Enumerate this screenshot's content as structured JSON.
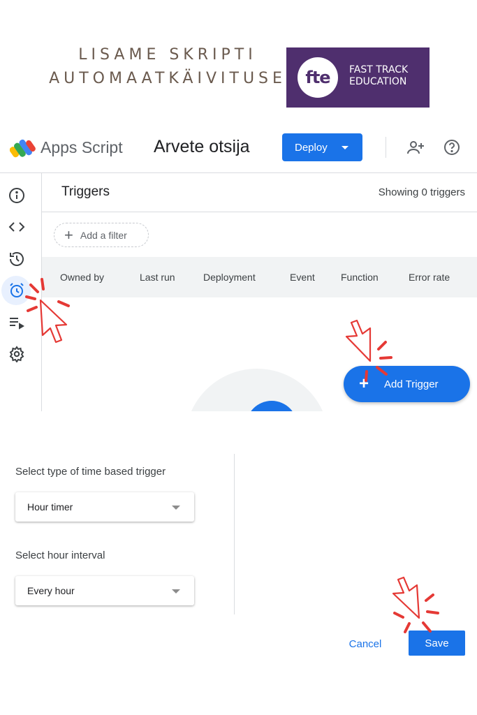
{
  "banner": {
    "line1": "LISAME SKRIPTI",
    "line2": "AUTOMAATKÄIVITUSE",
    "logo_mark": "fte",
    "logo_line1": "FAST TRACK",
    "logo_line2": "EDUCATION",
    "logo_bg": "#4f2f6e"
  },
  "app": {
    "brand": "Apps Script",
    "project_name": "Arvete otsija",
    "deploy_label": "Deploy",
    "accent": "#1a73e8",
    "header_icons": [
      "add-person-icon",
      "help-icon"
    ]
  },
  "sidebar": {
    "items": [
      {
        "name": "overview",
        "icon": "info-icon"
      },
      {
        "name": "editor",
        "icon": "code-icon"
      },
      {
        "name": "executions",
        "icon": "history-icon"
      },
      {
        "name": "triggers",
        "icon": "alarm-icon",
        "active": true
      },
      {
        "name": "executions-list",
        "icon": "playlist-icon"
      },
      {
        "name": "settings",
        "icon": "gear-icon"
      }
    ]
  },
  "triggers": {
    "title": "Triggers",
    "showing": "Showing 0 triggers",
    "filter_placeholder": "Add a filter",
    "columns": [
      "Owned by",
      "Last run",
      "Deployment",
      "Event",
      "Function",
      "Error rate"
    ],
    "add_button": "Add Trigger"
  },
  "dialog": {
    "type_label": "Select type of time based trigger",
    "type_value": "Hour timer",
    "interval_label": "Select hour interval",
    "interval_value": "Every hour",
    "cancel_label": "Cancel",
    "save_label": "Save"
  },
  "annotations": {
    "pointer_color": "#e53935",
    "pointer_icon": "click-pointer-icon"
  }
}
